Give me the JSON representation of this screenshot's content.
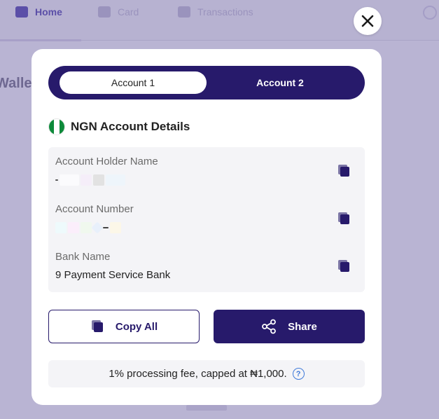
{
  "background": {
    "nav": [
      {
        "label": "Home"
      },
      {
        "label": "Card"
      },
      {
        "label": "Transactions"
      }
    ],
    "heading": "Wallet"
  },
  "colors": {
    "primary": "#271a6b",
    "overlay": "#b9b4d3",
    "panel": "#f4f4f7",
    "help": "#3f7ad9",
    "flag_green": "#0d8a3a"
  },
  "modal": {
    "tabs": [
      {
        "label": "Account 1",
        "active": true
      },
      {
        "label": "Account 2",
        "active": false
      }
    ],
    "section_title": "NGN Account Details",
    "flag_icon": "nigeria-flag-icon",
    "details": [
      {
        "label": "Account Holder Name",
        "value": ""
      },
      {
        "label": "Account Number",
        "value": ""
      },
      {
        "label": "Bank Name",
        "value": "9 Payment Service Bank"
      }
    ],
    "copy_all_label": "Copy All",
    "share_label": "Share",
    "fee_note": "1% processing fee, capped at ₦1,000.",
    "help_glyph": "?"
  }
}
